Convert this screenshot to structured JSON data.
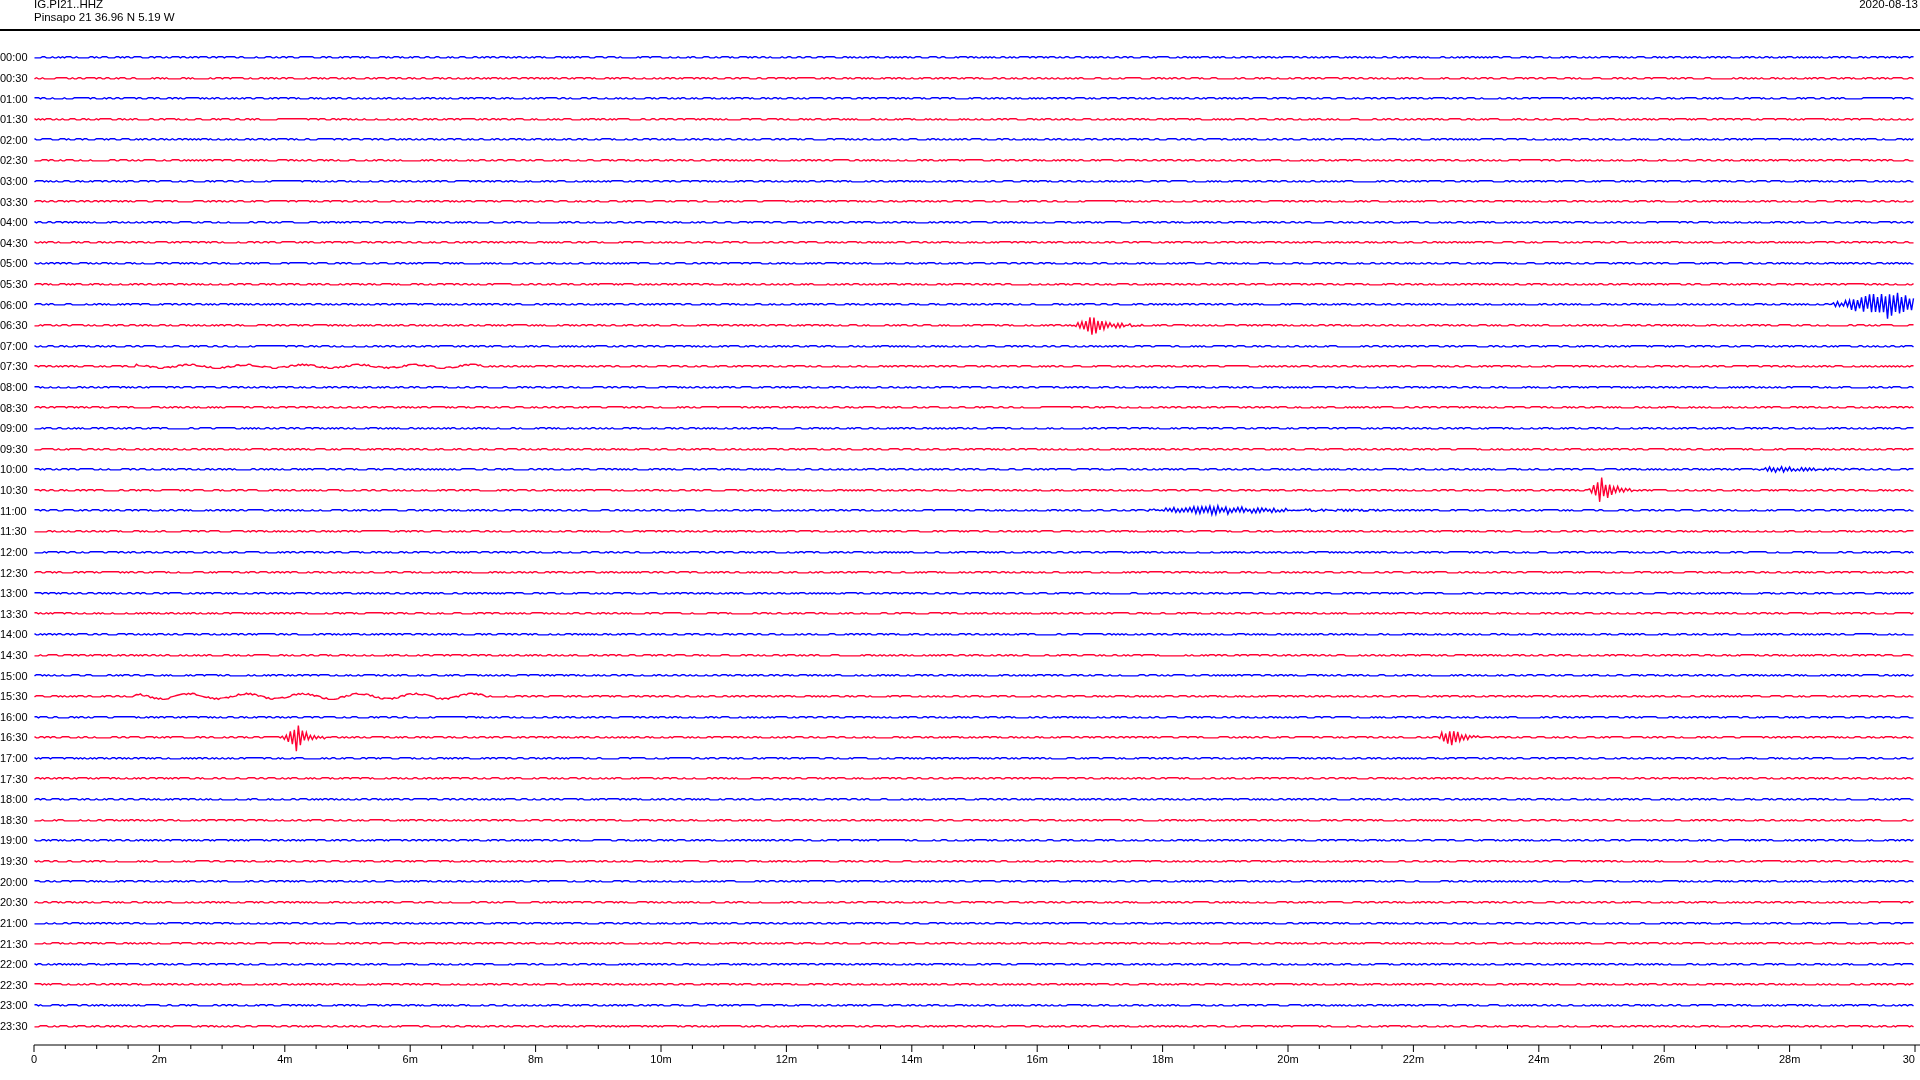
{
  "header": {
    "station": "IG.PI21..HHZ",
    "location": "Pinsapo 21  36.96 N 5.19 W",
    "date": "2020-08-13"
  },
  "traces": [
    {
      "label": "00:00",
      "color": "#0000ff"
    },
    {
      "label": "00:30",
      "color": "#ff0033"
    },
    {
      "label": "01:00",
      "color": "#0000ff"
    },
    {
      "label": "01:30",
      "color": "#ff0033"
    },
    {
      "label": "02:00",
      "color": "#0000ff"
    },
    {
      "label": "02:30",
      "color": "#ff0033"
    },
    {
      "label": "03:00",
      "color": "#0000ff"
    },
    {
      "label": "03:30",
      "color": "#ff0033"
    },
    {
      "label": "04:00",
      "color": "#0000ff"
    },
    {
      "label": "04:30",
      "color": "#ff0033"
    },
    {
      "label": "05:00",
      "color": "#0000ff"
    },
    {
      "label": "05:30",
      "color": "#ff0033"
    },
    {
      "label": "06:00",
      "color": "#0000ff"
    },
    {
      "label": "06:30",
      "color": "#ff0033"
    },
    {
      "label": "07:00",
      "color": "#0000ff"
    },
    {
      "label": "07:30",
      "color": "#ff0033"
    },
    {
      "label": "08:00",
      "color": "#0000ff"
    },
    {
      "label": "08:30",
      "color": "#ff0033"
    },
    {
      "label": "09:00",
      "color": "#0000ff"
    },
    {
      "label": "09:30",
      "color": "#ff0033"
    },
    {
      "label": "10:00",
      "color": "#0000ff"
    },
    {
      "label": "10:30",
      "color": "#ff0033"
    },
    {
      "label": "11:00",
      "color": "#0000ff"
    },
    {
      "label": "11:30",
      "color": "#ff0033"
    },
    {
      "label": "12:00",
      "color": "#0000ff"
    },
    {
      "label": "12:30",
      "color": "#ff0033"
    },
    {
      "label": "13:00",
      "color": "#0000ff"
    },
    {
      "label": "13:30",
      "color": "#ff0033"
    },
    {
      "label": "14:00",
      "color": "#0000ff"
    },
    {
      "label": "14:30",
      "color": "#ff0033"
    },
    {
      "label": "15:00",
      "color": "#0000ff"
    },
    {
      "label": "15:30",
      "color": "#ff0033"
    },
    {
      "label": "16:00",
      "color": "#0000ff"
    },
    {
      "label": "16:30",
      "color": "#ff0033"
    },
    {
      "label": "17:00",
      "color": "#0000ff"
    },
    {
      "label": "17:30",
      "color": "#ff0033"
    },
    {
      "label": "18:00",
      "color": "#0000ff"
    },
    {
      "label": "18:30",
      "color": "#ff0033"
    },
    {
      "label": "19:00",
      "color": "#0000ff"
    },
    {
      "label": "19:30",
      "color": "#ff0033"
    },
    {
      "label": "20:00",
      "color": "#0000ff"
    },
    {
      "label": "20:30",
      "color": "#ff0033"
    },
    {
      "label": "21:00",
      "color": "#0000ff"
    },
    {
      "label": "21:30",
      "color": "#ff0033"
    },
    {
      "label": "22:00",
      "color": "#0000ff"
    },
    {
      "label": "22:30",
      "color": "#ff0033"
    },
    {
      "label": "23:00",
      "color": "#0000ff"
    },
    {
      "label": "23:30",
      "color": "#ff0033"
    }
  ],
  "time_axis": {
    "ticks": [
      "0",
      "2m",
      "4m",
      "6m",
      "8m",
      "10m",
      "12m",
      "14m",
      "16m",
      "18m",
      "20m",
      "22m",
      "24m",
      "26m",
      "28m",
      "30"
    ]
  }
}
